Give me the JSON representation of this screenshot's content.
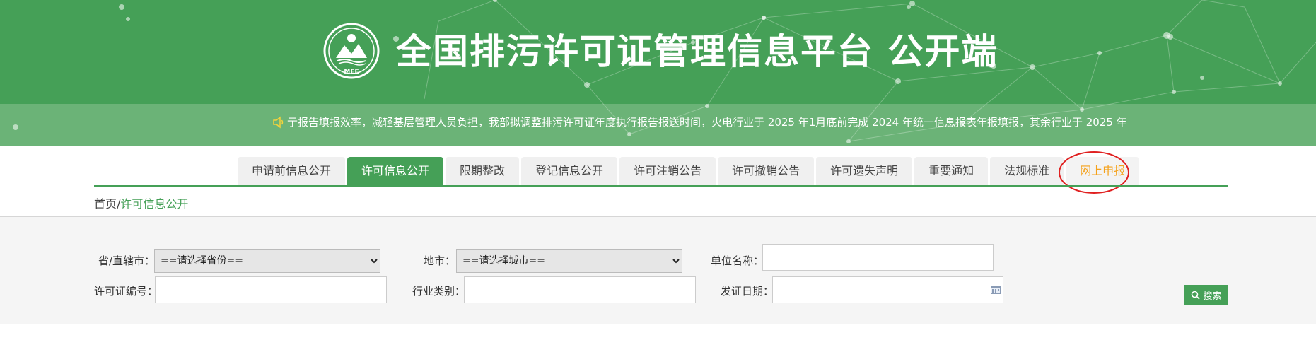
{
  "header": {
    "title": "全国排污许可证管理信息平台  公开端",
    "logo_text": "MEE",
    "ticker": "提高报告填报效率，减轻基层管理人员负担，我部拟调整排污许可证年度执行报告报送时间，火电行业于 2025 年1月底前完成 2024 年统一信息报表年报填报，其余行业于 2025 年",
    "ticker_visible": "亍报告填报效率，减轻基层管理人员负担，我部拟调整排污许可证年度执行报告报送时间，火电行业于 2025 年1月底前完成 2024 年统一信息报表年报填报，其余行业于 2025 年"
  },
  "nav": {
    "tabs": [
      {
        "label": "申请前信息公开"
      },
      {
        "label": "许可信息公开"
      },
      {
        "label": "限期整改"
      },
      {
        "label": "登记信息公开"
      },
      {
        "label": "许可注销公告"
      },
      {
        "label": "许可撤销公告"
      },
      {
        "label": "许可遗失声明"
      },
      {
        "label": "重要通知"
      },
      {
        "label": "法规标准"
      },
      {
        "label": "网上申报"
      }
    ],
    "active_index": 1
  },
  "breadcrumb": {
    "home": "首页",
    "separator": "/",
    "current": "许可信息公开"
  },
  "search": {
    "province_label": "省/直辖市：",
    "province_value": "==请选择省份==",
    "city_label": "地市：",
    "city_value": "==请选择城市==",
    "unit_label": "单位名称：",
    "unit_value": "",
    "license_label": "许可证编号：",
    "license_value": "",
    "industry_label": "行业类别：",
    "industry_value": "",
    "date_label": "发证日期：",
    "date_value": "",
    "search_button": "搜索"
  },
  "colors": {
    "brand_green": "#45a057",
    "highlight_orange": "#f5a21b",
    "annotation_red": "#e02020"
  }
}
